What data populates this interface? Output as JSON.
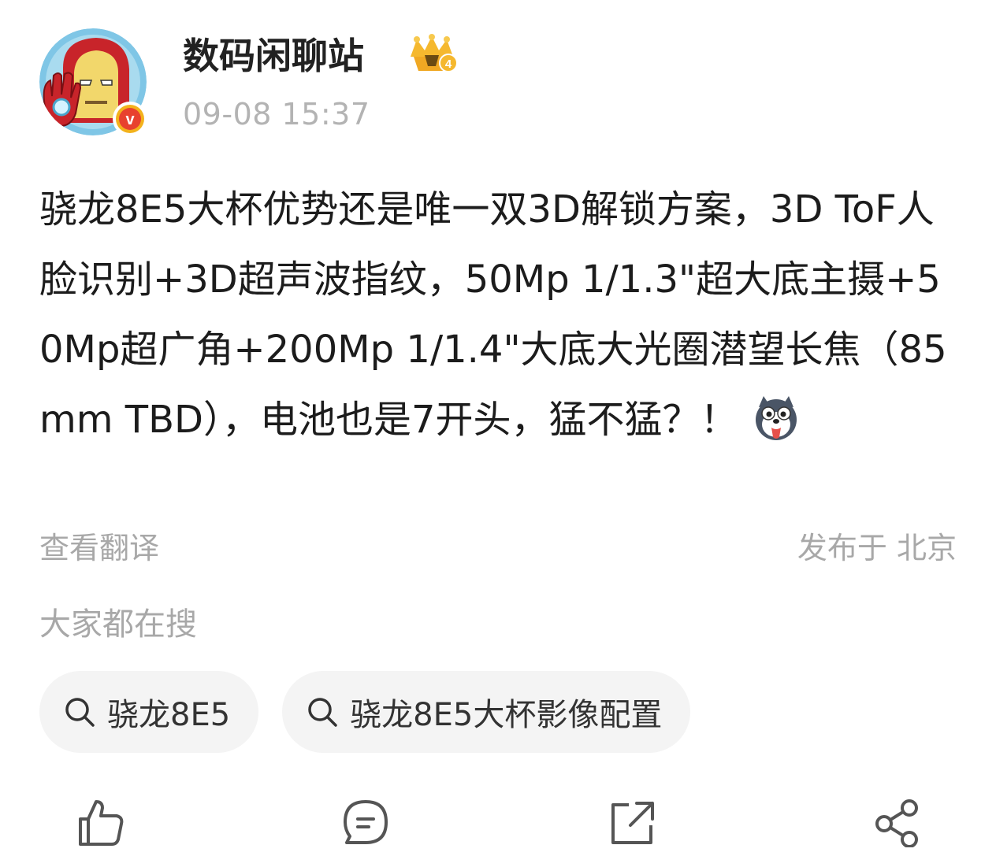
{
  "post": {
    "author": {
      "name": "数码闲聊站",
      "avatar_icon": "iron-man-avatar",
      "verified_badge": "v",
      "level_badge": "crown-4-icon"
    },
    "timestamp": "09-08 15:37",
    "text": "骁龙8E5大杯优势还是唯一双3D解锁方案，3D ToF人脸识别+3D超声波指纹，50Mp 1/1.3\"超大底主摄+50Mp超广角+200Mp 1/1.4\"大底大光圈潜望长焦（85mm TBD），电池也是7开头，猛不猛？！",
    "emoji": "husky-dog-emoji",
    "translate_label": "查看翻译",
    "location": "发布于 北京"
  },
  "trending": {
    "title": "大家都在搜",
    "chips": [
      {
        "label": "骁龙8E5",
        "icon": "search-icon"
      },
      {
        "label": "骁龙8E5大杯影像配置",
        "icon": "search-icon"
      }
    ]
  },
  "actions": {
    "like_icon": "thumbs-up-icon",
    "comment_icon": "comment-icon",
    "repost_icon": "repost-icon",
    "share_icon": "share-icon"
  },
  "colors": {
    "text": "#1c1c1c",
    "meta": "#a8a8a8",
    "chip_bg": "#f4f4f4",
    "verified_red": "#e8412e",
    "crown_gold": "#f0a823"
  }
}
